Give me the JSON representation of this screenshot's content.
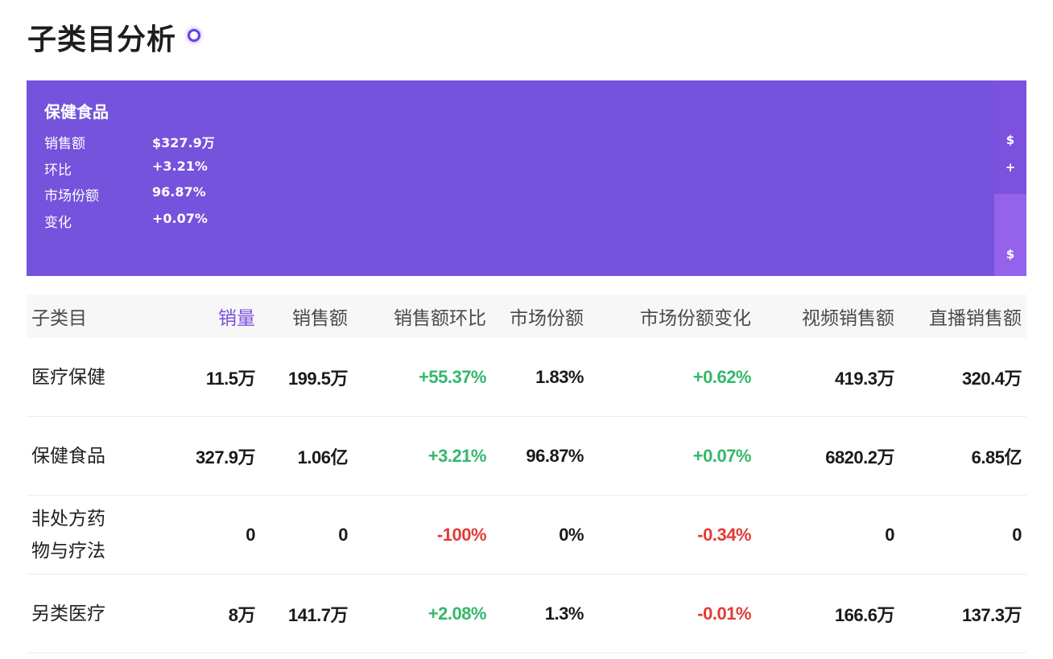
{
  "header": {
    "title": "子类目分析"
  },
  "treemap": {
    "main": {
      "name": "保健食品",
      "rows": [
        {
          "label": "销售额",
          "value": "$327.9万"
        },
        {
          "label": "环比",
          "value": "+3.21%"
        },
        {
          "label": "市场份额",
          "value": "96.87%"
        },
        {
          "label": "变化",
          "value": "+0.07%"
        }
      ]
    },
    "side_top": {
      "glyph1": "$",
      "glyph2": "+"
    },
    "side_bottom": {
      "glyph1": "$"
    },
    "colors": {
      "main": "#7553dc",
      "side_top": "#7b51dd",
      "side_bottom": "#9562ec"
    }
  },
  "table": {
    "headers": [
      "子类目",
      "销量",
      "销售额",
      "销售额环比",
      "市场份额",
      "市场份额变化",
      "视频销售额",
      "直播销售额"
    ],
    "active_sort_column": "销量",
    "rows": [
      {
        "name": "医疗保健",
        "sales_qty": "11.5万",
        "sales_amt": "199.5万",
        "amt_mom": "+55.37%",
        "share": "1.83%",
        "share_change": "+0.62%",
        "video": "419.3万",
        "live": "320.4万"
      },
      {
        "name": "保健食品",
        "sales_qty": "327.9万",
        "sales_amt": "1.06亿",
        "amt_mom": "+3.21%",
        "share": "96.87%",
        "share_change": "+0.07%",
        "video": "6820.2万",
        "live": "6.85亿"
      },
      {
        "name": "非处方药物与疗法",
        "name_line1": "非处方药",
        "name_line2": "物与疗法",
        "sales_qty": "0",
        "sales_amt": "0",
        "amt_mom": "-100%",
        "share": "0%",
        "share_change": "-0.34%",
        "video": "0",
        "live": "0"
      },
      {
        "name": "另类医疗",
        "sales_qty": "8万",
        "sales_amt": "141.7万",
        "amt_mom": "+2.08%",
        "share": "1.3%",
        "share_change": "-0.01%",
        "video": "166.6万",
        "live": "137.3万"
      }
    ],
    "colors": {
      "positive": "#34b86b",
      "negative": "#e23b35",
      "active_header": "#7a4fe0"
    }
  }
}
